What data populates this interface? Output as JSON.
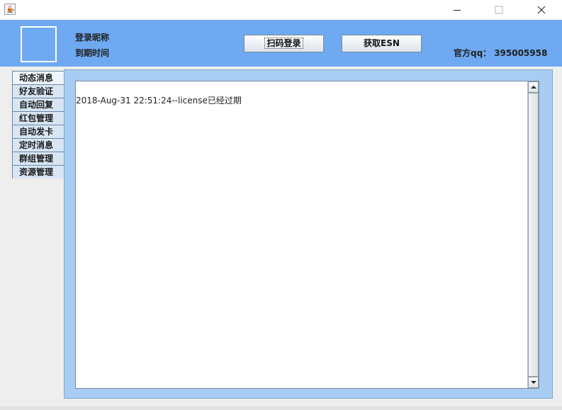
{
  "header": {
    "nickname_label": "登录昵称",
    "expiry_label": "到期时间",
    "scan_login_label": "扫码登录",
    "get_esn_label": "获取ESN",
    "qq_label": "官方qq：",
    "qq_number": "395005958"
  },
  "tabs": [
    {
      "label": "动态消息",
      "selected": true
    },
    {
      "label": "好友验证",
      "selected": false
    },
    {
      "label": "自动回复",
      "selected": false
    },
    {
      "label": "红包管理",
      "selected": false
    },
    {
      "label": "自动发卡",
      "selected": false
    },
    {
      "label": "定时消息",
      "selected": false
    },
    {
      "label": "群组管理",
      "selected": false
    },
    {
      "label": "资源管理",
      "selected": false
    }
  ],
  "log": {
    "lines": [
      "2018-Aug-31 22:51:24--license已经过期"
    ]
  },
  "colors": {
    "header_bg": "#6ea9f2",
    "panel_bg": "#a9cdf2",
    "tab_bg": "#d8e5f3"
  },
  "icons": {
    "app": "java-cup-icon",
    "minimize": "minimize-icon",
    "maximize": "maximize-icon",
    "close": "close-icon"
  }
}
